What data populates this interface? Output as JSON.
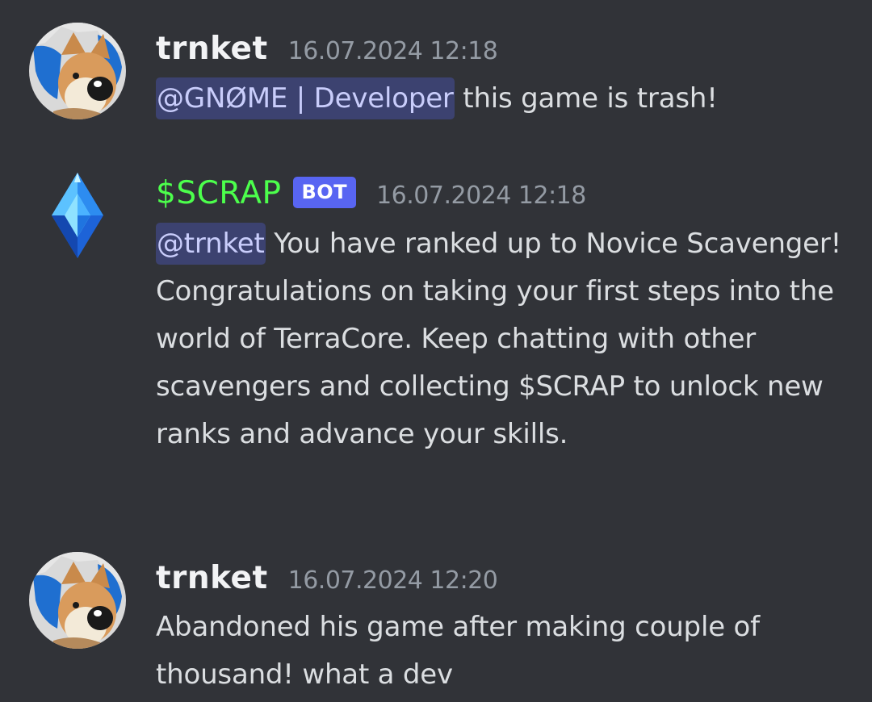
{
  "messages": [
    {
      "author": "trnket",
      "timestamp": "16.07.2024 12:18",
      "mention": "@GNØME | Developer",
      "text": " this game is trash!",
      "avatar_icon": "corgi-avatar-icon"
    },
    {
      "author": "$SCRAP",
      "badge": "BOT",
      "timestamp": "16.07.2024 12:18",
      "mention": "@trnket",
      "text": " You have ranked up to Novice Scavenger! Congratulations on taking your first steps into the world of TerraCore. Keep chatting with other scavengers and collecting $SCRAP to unlock new ranks and advance your skills.",
      "avatar_icon": "blue-crystal-icon",
      "author_color": "#4cff4c"
    },
    {
      "author": "trnket",
      "timestamp": "16.07.2024 12:20",
      "text": "Abandoned his game after making couple of thousand! what a dev",
      "avatar_icon": "corgi-avatar-icon"
    }
  ],
  "colors": {
    "background": "#313338",
    "mention_bg": "#3c4270",
    "mention_text": "#c9cdfb",
    "bot_badge": "#5865f2",
    "timestamp": "#949ba4"
  }
}
